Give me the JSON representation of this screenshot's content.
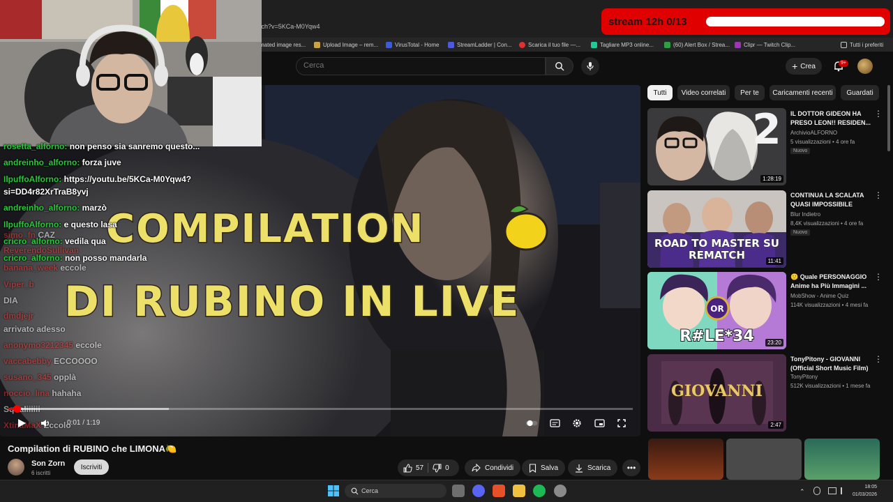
{
  "browser": {
    "url": "tch?v=5KCa-M0Yqw4",
    "bookmarks": [
      "mated image res...",
      "Upload Image – rem...",
      "VirusTotal - Home",
      "StreamLadder | Con...",
      "Scarica il tuo file —...",
      "Tagliare MP3 online...",
      "(60) Alert Box / Strea...",
      "Clipr — Twitch Clip..."
    ],
    "all_bookmarks": "Tutti i preferiti"
  },
  "header": {
    "search_placeholder": "Cerca",
    "create_label": "Crea",
    "notif_count": "9+"
  },
  "stream_overlay": {
    "label": "stream 12h 0/13",
    "color": "#e00000"
  },
  "video": {
    "title_line1": "COMPILATION",
    "title_line2": "DI RUBINO IN LIVE",
    "time": "0:01 / 1:19",
    "progress": 0.013
  },
  "chat": [
    {
      "user": "rosetta_alforno:",
      "msg": "non penso sia sanremo questo...",
      "faded": false
    },
    {
      "user": "andreinho_alforno:",
      "msg": "forza juve",
      "faded": false
    },
    {
      "user": "IlpuffoAlforno:",
      "msg": "https://youtu.be/5KCa-M0Yqw4?",
      "faded": false
    },
    {
      "user": "",
      "msg": "si=DD4r82XrTraB8yvj",
      "faded": false
    },
    {
      "user": "andreinho_alforno:",
      "msg": "marzò",
      "faded": false
    },
    {
      "user": "IlpuffoAlforno:",
      "msg": "e questo lasa",
      "faded": false
    },
    {
      "user": "cricro_alforno:",
      "msg": "vedila qua",
      "faded": false
    },
    {
      "user": "cricro_alforno:",
      "msg": "non posso mandarla",
      "faded": false
    },
    {
      "user": "simo_fn",
      "msg": "CAZ",
      "faded": true
    },
    {
      "user": "ReverendoSullivan",
      "msg": "",
      "faded": true
    },
    {
      "user": "banana_week",
      "msg": "eccole",
      "faded": true
    },
    {
      "user": "Viper_b",
      "msg": "",
      "faded": true
    },
    {
      "user": "",
      "msg": "DIA",
      "faded": true
    },
    {
      "user": "dmdjejr",
      "msg": "",
      "faded": true
    },
    {
      "user": "",
      "msg": "arrivato adesso",
      "faded": true
    },
    {
      "user": "anonymo3212345",
      "msg": "eccole",
      "faded": true
    },
    {
      "user": "vaccabebby",
      "msg": "ECCOOOO",
      "faded": true
    },
    {
      "user": "susano_345",
      "msg": "opplà",
      "faded": true
    },
    {
      "user": "noccio_lina",
      "msg": "hahaha",
      "faded": true
    },
    {
      "user": "",
      "msg": "Squaliiiiii",
      "faded": true
    },
    {
      "user": "XtinaMaX",
      "msg": "Eccolo",
      "faded": true
    }
  ],
  "below": {
    "title": "Compilation di RUBINO che LIMONA🍋",
    "channel": "Son Zorn",
    "subs": "6 iscritti",
    "subscribe": "Iscriviti",
    "likes": "57",
    "dislikes": "0",
    "share": "Condividi",
    "save": "Salva",
    "download": "Scarica"
  },
  "chips": [
    "Tutti",
    "Video correlati",
    "Per te",
    "Caricamenti recenti",
    "Guardati"
  ],
  "recommendations": [
    {
      "title": "IL DOTTOR GIDEON HA PRESO LEON!! RESIDEN...",
      "channel": "ArchivioALFORNO",
      "meta": "5 visualizzazioni • 4 ore fa",
      "badge": "Nuovo",
      "duration": "1:28:19",
      "thumb_text": "2"
    },
    {
      "title": "CONTINUA LA SCALATA QUASI IMPOSSIBILE",
      "channel": "Blur Indietro",
      "meta": "8,4K visualizzazioni • 4 ore fa",
      "badge": "Nuovo",
      "duration": "11:41",
      "thumb_text": "ROAD TO MASTER SU REMATCH"
    },
    {
      "title": "🙂 Quale PERSONAGGIO Anime ha Più Immagini ...",
      "channel": "MobShow - Anime Quiz",
      "meta": "114K visualizzazioni • 4 mesi fa",
      "badge": "",
      "duration": "23:20",
      "thumb_text": "R#LE*34"
    },
    {
      "title": "TonyPitony - GIOVANNI (Official Short Music Film)",
      "channel": "TonyPitony",
      "meta": "512K visualizzazioni • 1 mese fa",
      "badge": "",
      "duration": "2:47",
      "thumb_text": "GIOVANNI"
    }
  ],
  "taskbar": {
    "search": "Cerca",
    "time": "18:05",
    "date": "01/03/2026"
  }
}
